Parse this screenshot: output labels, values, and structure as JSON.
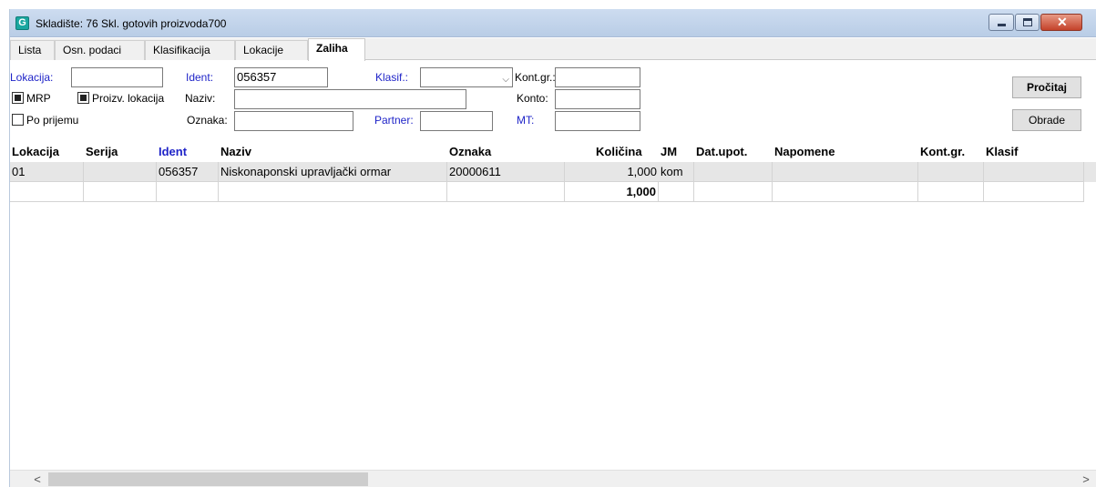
{
  "window": {
    "title": "Skladište: 76 Skl. gotovih proizvoda700",
    "app_icon_letter": "G",
    "close_glyph": "✕"
  },
  "tabs": [
    {
      "label": "Lista",
      "active": false
    },
    {
      "label": "Osn. podaci",
      "active": false
    },
    {
      "label": "Klasifikacija",
      "active": false
    },
    {
      "label": "Lokacije",
      "active": false
    },
    {
      "label": "Zaliha",
      "active": true
    }
  ],
  "filters": {
    "lokacija_label": "Lokacija:",
    "lokacija_value": "",
    "ident_label": "Ident:",
    "ident_value": "056357",
    "klasif_label": "Klasif.:",
    "klasif_value": "",
    "kontgr_label": "Kont.gr.:",
    "kontgr_value": "",
    "mrp_label": "MRP",
    "mrp_checked": true,
    "proizv_label": "Proizv. lokacija",
    "proizv_checked": true,
    "naziv_label": "Naziv:",
    "naziv_value": "",
    "konto_label": "Konto:",
    "konto_value": "",
    "poprijemu_label": "Po prijemu",
    "poprijemu_checked": false,
    "oznaka_label": "Oznaka:",
    "oznaka_value": "",
    "partner_label": "Partner:",
    "partner_value": "",
    "mt_label": "MT:",
    "mt_value": ""
  },
  "buttons": {
    "procitaj": "Pročitaj",
    "obrade": "Obrade"
  },
  "grid": {
    "columns": [
      "Lokacija",
      "Serija",
      "Ident",
      "Naziv",
      "Oznaka",
      "Količina",
      "JM",
      "Dat.upot.",
      "Napomene",
      "Kont.gr.",
      "Klasif"
    ],
    "rows": [
      [
        "01",
        "",
        "056357",
        "Niskonaponski upravljački ormar",
        "20000611",
        "1,000",
        "kom",
        "",
        "",
        "",
        ""
      ]
    ],
    "total_kolicina": "1,000"
  },
  "scrollbar": {
    "left_arrow": "<",
    "right_arrow": ">"
  },
  "colors": {
    "label_blue": "#1f24c8",
    "selected_row": "#e6e6e6",
    "titlebar": "#c3d4ea"
  }
}
